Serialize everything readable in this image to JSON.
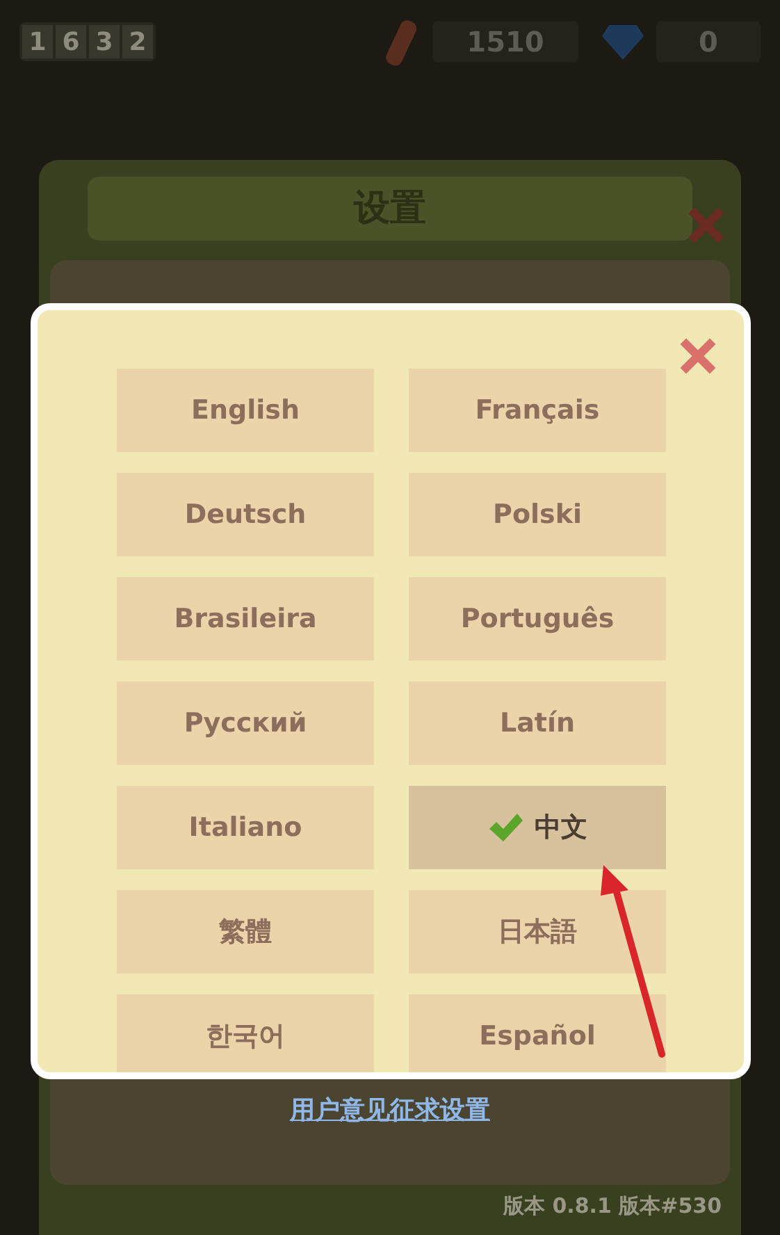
{
  "top_bar": {
    "counter_digits": [
      "1",
      "6",
      "3",
      "2"
    ],
    "wood": "1510",
    "gems": "0"
  },
  "settings": {
    "title": "设置",
    "feedback_link": "用户意见征求设置",
    "version": "版本 0.8.1 版本#530"
  },
  "language_dialog": {
    "languages": [
      {
        "label": "English",
        "selected": false
      },
      {
        "label": "Français",
        "selected": false
      },
      {
        "label": "Deutsch",
        "selected": false
      },
      {
        "label": "Polski",
        "selected": false
      },
      {
        "label": "Brasileira",
        "selected": false
      },
      {
        "label": "Português",
        "selected": false
      },
      {
        "label": "Русский",
        "selected": false
      },
      {
        "label": "Latín",
        "selected": false
      },
      {
        "label": "Italiano",
        "selected": false
      },
      {
        "label": "中文",
        "selected": true
      },
      {
        "label": "繁體",
        "selected": false
      },
      {
        "label": "日本語",
        "selected": false
      },
      {
        "label": "한국어",
        "selected": false
      },
      {
        "label": "Español",
        "selected": false
      }
    ]
  }
}
